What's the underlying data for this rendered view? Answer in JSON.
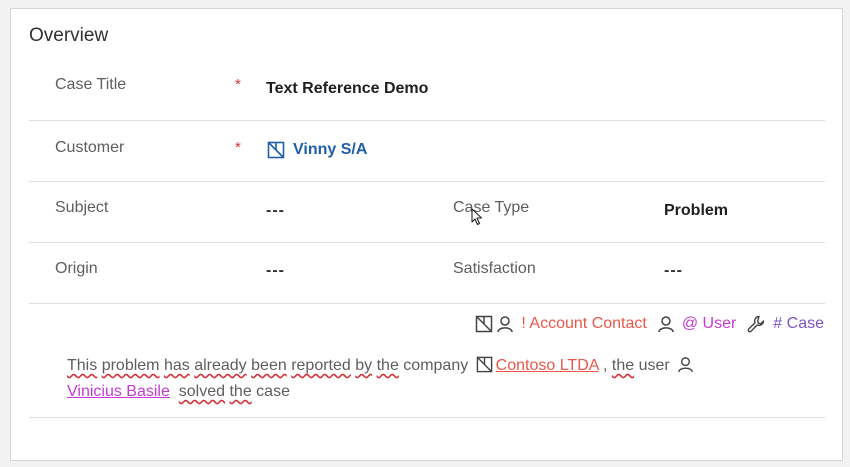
{
  "section": {
    "title": "Overview"
  },
  "fields": {
    "case_title": {
      "label": "Case Title",
      "required": "*",
      "value": "Text Reference Demo"
    },
    "customer": {
      "label": "Customer",
      "required": "*",
      "value": "Vinny S/A",
      "icon": "account-icon"
    },
    "subject": {
      "label": "Subject",
      "value": "---"
    },
    "case_type": {
      "label": "Case Type",
      "value": "Problem"
    },
    "origin": {
      "label": "Origin",
      "value": "---"
    },
    "satisfaction": {
      "label": "Satisfaction",
      "value": "---"
    }
  },
  "reference_toolbar": {
    "account_contact": "! Account Contact",
    "user": "@ User",
    "case": "# Case",
    "icons": [
      "account-icon",
      "contact-icon",
      "user-icon",
      "wrench-icon"
    ]
  },
  "note": {
    "w1": "This",
    "w2": "problem",
    "w3": "has",
    "w4": "already",
    "w5": "been",
    "w6": "reported",
    "w7": "by",
    "w8": "the",
    "w9": "company",
    "account_ref": "Contoso LTDA",
    "w10": ",",
    "w11": "the",
    "w12": "user",
    "user_ref": "Vinicius Basile",
    "w13": "solved",
    "w14": "the",
    "w15": "case"
  },
  "colors": {
    "lookup": "#1f5fa8",
    "account_ref": "#e8574b",
    "user_ref": "#c43bd3",
    "case_ref": "#7b55c8",
    "required": "#d13438"
  }
}
